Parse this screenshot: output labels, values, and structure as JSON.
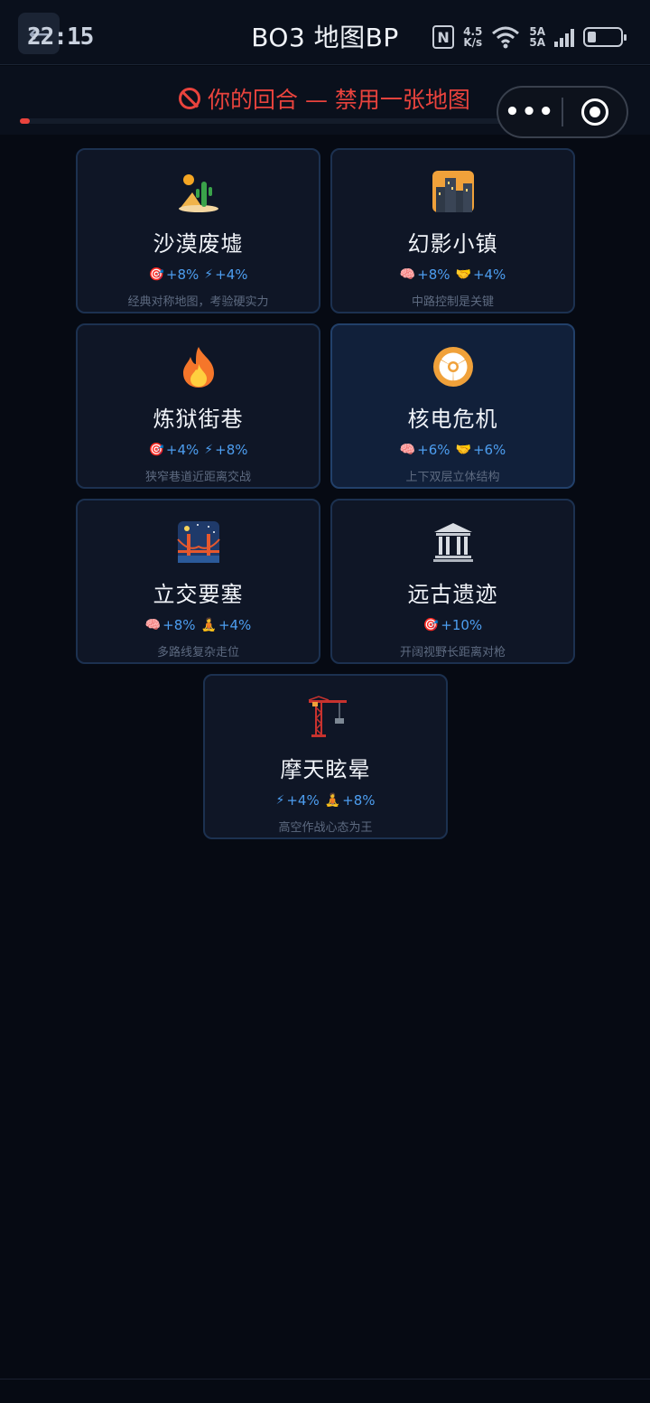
{
  "status_bar": {
    "time": "22:15",
    "net_speed_value": "4.5",
    "net_speed_unit": "K/s",
    "signal_1": "5A",
    "signal_2": "5A",
    "battery_level": 0.25
  },
  "header": {
    "title": "BO3 地图BP"
  },
  "turn": {
    "message": "你的回合 — 禁用一张地图",
    "progress": 0.02,
    "accent_color": "#e9433d"
  },
  "capsule": {
    "more_label": "•••"
  },
  "maps": [
    {
      "name": "沙漠废墟",
      "icon": "desert-icon",
      "stats": [
        {
          "icon": "🎯",
          "value": "+8%"
        },
        {
          "icon": "⚡",
          "value": "+4%"
        }
      ],
      "desc": "经典对称地图，考验硬实力",
      "highlighted": false
    },
    {
      "name": "幻影小镇",
      "icon": "cityscape-icon",
      "stats": [
        {
          "icon": "🧠",
          "value": "+8%"
        },
        {
          "icon": "🤝",
          "value": "+4%"
        }
      ],
      "desc": "中路控制是关键",
      "highlighted": false
    },
    {
      "name": "炼狱街巷",
      "icon": "fire-icon",
      "stats": [
        {
          "icon": "🎯",
          "value": "+4%"
        },
        {
          "icon": "⚡",
          "value": "+8%"
        }
      ],
      "desc": "狭窄巷道近距离交战",
      "highlighted": false
    },
    {
      "name": "核电危机",
      "icon": "radioactive-icon",
      "stats": [
        {
          "icon": "🧠",
          "value": "+6%"
        },
        {
          "icon": "🤝",
          "value": "+6%"
        }
      ],
      "desc": "上下双层立体结构",
      "highlighted": true
    },
    {
      "name": "立交要塞",
      "icon": "bridge-at-night-icon",
      "stats": [
        {
          "icon": "🧠",
          "value": "+8%"
        },
        {
          "icon": "🧘",
          "value": "+4%"
        }
      ],
      "desc": "多路线复杂走位",
      "highlighted": false
    },
    {
      "name": "远古遗迹",
      "icon": "classical-building-icon",
      "stats": [
        {
          "icon": "🎯",
          "value": "+10%"
        }
      ],
      "desc": "开阔视野长距离对枪",
      "highlighted": false
    },
    {
      "name": "摩天眩晕",
      "icon": "construction-crane-icon",
      "stats": [
        {
          "icon": "⚡",
          "value": "+4%"
        },
        {
          "icon": "🧘",
          "value": "+8%"
        }
      ],
      "desc": "高空作战心态为王",
      "highlighted": false
    }
  ],
  "colors": {
    "background": "#060a13",
    "card_bg": "#0f1626",
    "card_border": "#1c3150",
    "stat_blue": "#4d9ef0"
  }
}
